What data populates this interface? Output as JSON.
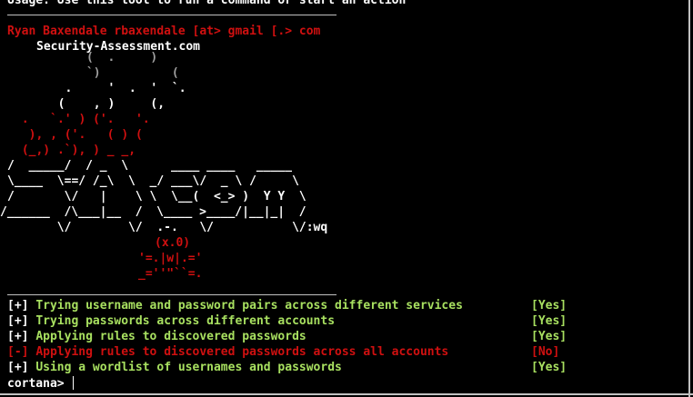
{
  "theme": {
    "background": "#000000",
    "white": "#ffffff",
    "red": "#d01010",
    "green": "#a8e060",
    "gray": "#a0a0a0"
  },
  "header": {
    "cutoff_line": "Usage: Use this tool to run a command or start an action",
    "author": "Ryan Baxendale rbaxendale [at> gmail [.> com",
    "site": "Security-Assessment.com"
  },
  "ascii_art": {
    "smoke": [
      {
        "text": "      (  .     )",
        "color": "gray"
      },
      {
        "text": "      `)          (",
        "color": "gray"
      },
      {
        "text": "   .     '  .  '  `.",
        "color": "white"
      },
      {
        "text": "  (    , )     (,",
        "color": "white"
      }
    ],
    "fire": [
      {
        "text": " .   `.' ) ('.   '.",
        "color": "red"
      },
      {
        "text": "  ), , ('.   ( ) (",
        "color": "red"
      },
      {
        "text": " (_,) .`), ) _ _,",
        "color": "red"
      }
    ],
    "logo": [
      "/  _____/  / _  \\      ____ ____   _____",
      "\\____  \\==/ /_\\  \\  _/ ___\\/  _ \\ /     \\",
      "/       \\/   |    \\ \\  \\__(  <_> )  Y Y  \\",
      "/______  /\\___|__  /  \\____ >____/|__|_|  /",
      "       \\/        \\/  .-.   \\/           \\/:wq"
    ],
    "face": [
      "(x.0)",
      "'=.|w|.='",
      "_=''\"``=."
    ]
  },
  "checks": [
    {
      "marker": "[+]",
      "text": "Trying username and password pairs across different services",
      "result": "[Yes]",
      "status": "ok"
    },
    {
      "marker": "[+]",
      "text": "Trying passwords across different accounts",
      "result": "[Yes]",
      "status": "ok"
    },
    {
      "marker": "[+]",
      "text": "Applying rules to discovered passwords",
      "result": "[Yes]",
      "status": "ok"
    },
    {
      "marker": "[-]",
      "text": "Applying rules to discovered passwords across all accounts",
      "result": "[No]",
      "status": "fail"
    },
    {
      "marker": "[+]",
      "text": "Using a wordlist of usernames and passwords",
      "result": "[Yes]",
      "status": "ok"
    }
  ],
  "prompt": {
    "label": "cortana>",
    "input_value": ""
  }
}
